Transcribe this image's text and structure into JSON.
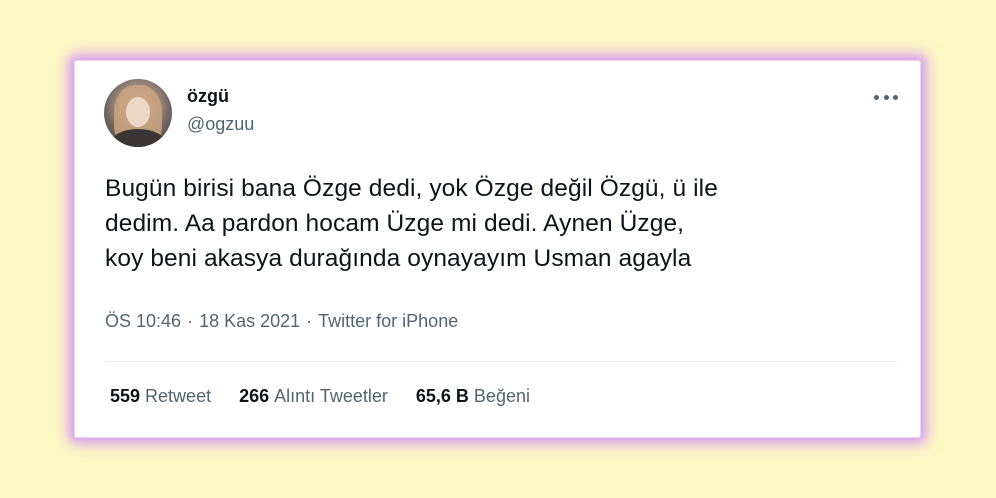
{
  "tweet": {
    "author": {
      "name": "özgü",
      "handle": "@ogzuu",
      "avatar_icon": "profile-photo"
    },
    "more_icon": "ellipsis-horizontal-icon",
    "text_lines": [
      "Bugün birisi bana Özge dedi, yok Özge değil Özgü, ü ile",
      "dedim. Aa pardon hocam Üzge mi dedi. Aynen Üzge,",
      "koy beni akasya durağında oynayayım Usman agayla"
    ],
    "meta": {
      "time": "ÖS 10:46",
      "date": "18 Kas 2021",
      "source": "Twitter for iPhone",
      "separator": "·"
    },
    "stats": [
      {
        "value": "559",
        "label": "Retweet"
      },
      {
        "value": "266",
        "label": "Alıntı Tweetler"
      },
      {
        "value": "65,6 B",
        "label": "Beğeni"
      }
    ]
  },
  "colors": {
    "background": "#fdf8c4",
    "card": "#ffffff",
    "glow": "#d79df0",
    "text_primary": "#0f1419",
    "text_secondary": "#536471"
  }
}
